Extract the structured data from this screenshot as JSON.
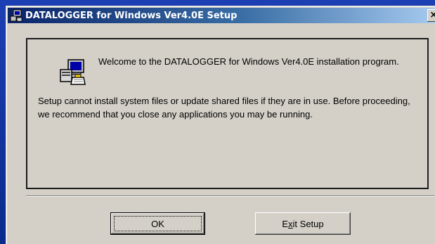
{
  "window": {
    "title": "DATALOGGER for Windows Ver4.0E Setup",
    "close_label": "×"
  },
  "content": {
    "welcome": "Welcome to the DATALOGGER for Windows Ver4.0E installation program.",
    "message": "Setup cannot install system files or update shared files if they are in use. Before proceeding, we recommend that you close any applications you may be running."
  },
  "buttons": {
    "ok_label": "OK",
    "exit_prefix": "E",
    "exit_mnemonic": "x",
    "exit_suffix": "it Setup"
  },
  "icons": {
    "title": "setup-computer-icon",
    "main": "setup-computer-icon",
    "close": "close-icon"
  },
  "colors": {
    "title_gradient_start": "#0a246a",
    "title_gradient_end": "#a6caf0",
    "dialog_face": "#d4d0c8",
    "desktop": "#0a2a8c"
  }
}
